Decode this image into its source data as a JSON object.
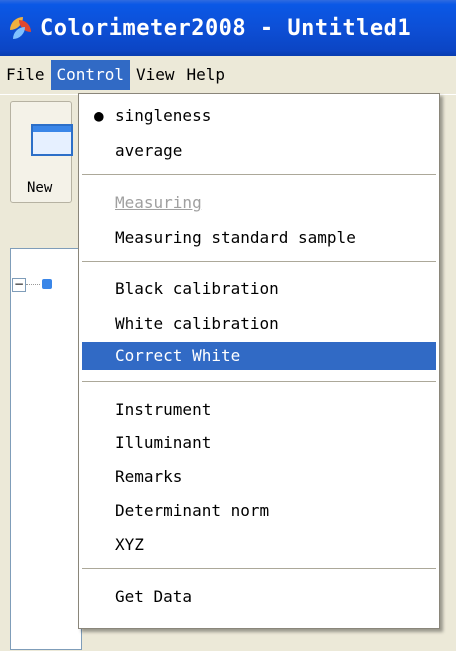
{
  "window": {
    "title": "Colorimeter2008 - Untitled1"
  },
  "menubar": {
    "file": "File",
    "control": "Control",
    "view": "View",
    "help": "Help"
  },
  "toolbar": {
    "new_label": "New"
  },
  "tree": {
    "expander": "−"
  },
  "control_menu": {
    "singleness": "singleness",
    "average": "average",
    "measuring": "Measuring",
    "measuring_standard": "Measuring standard sample",
    "black_calibration": "Black calibration",
    "white_calibration": "White calibration",
    "correct_white": "Correct White",
    "instrument": "Instrument",
    "illuminant": "Illuminant",
    "remarks": "Remarks",
    "determinant_norm": "Determinant norm",
    "xyz": "XYZ",
    "get_data": "Get Data"
  },
  "colors": {
    "accent": "#316ac5",
    "titlebar": "#0c45c4"
  },
  "icons": {
    "app": "colorimeter-app-icon",
    "bullet": "radio-bullet-icon",
    "new": "new-document-icon"
  }
}
